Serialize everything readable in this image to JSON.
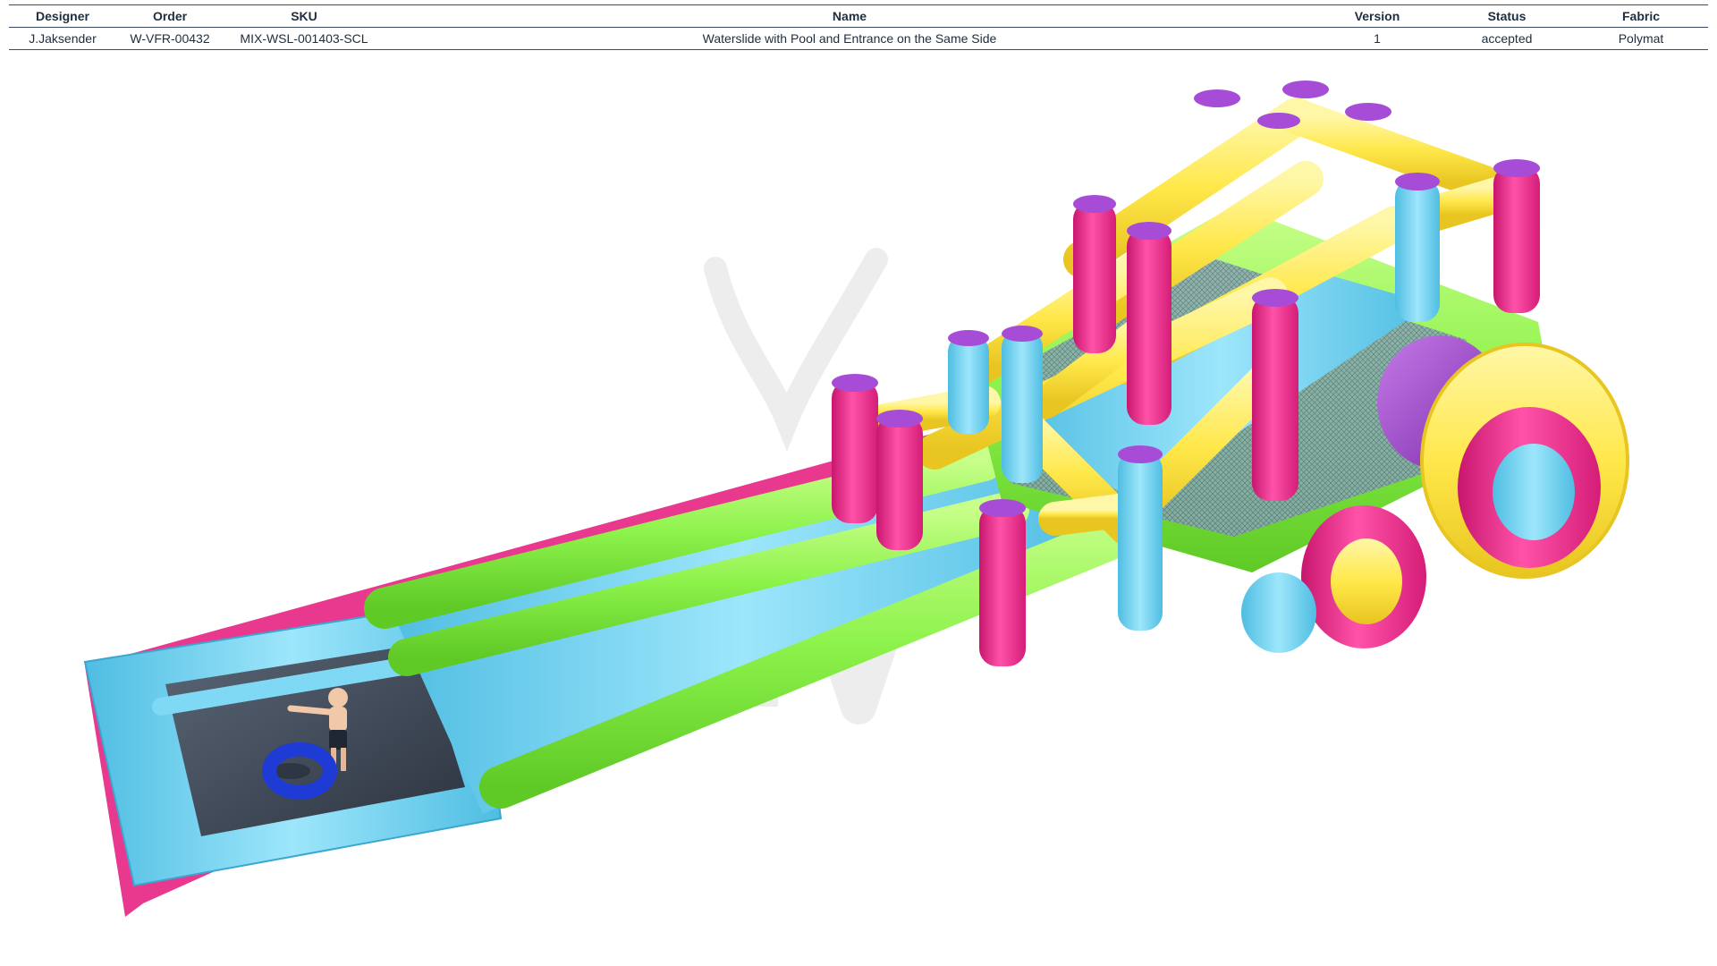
{
  "spec_table": {
    "headers": {
      "designer": "Designer",
      "order": "Order",
      "sku": "SKU",
      "name": "Name",
      "version": "Version",
      "status": "Status",
      "fabric": "Fabric"
    },
    "row": {
      "designer": "J.Jaksender",
      "order": "W-VFR-00432",
      "sku": "MIX-WSL-001403-SCL",
      "name": "Waterslide with Pool and Entrance on the Same Side",
      "version": "1",
      "status": "accepted",
      "fabric": "Polymat"
    }
  },
  "render": {
    "subject": "inflatable-waterslide-render",
    "watermark_style": "faint-grey-logo",
    "colors": {
      "pink": "#ff3d9a",
      "yellow": "#ffe84a",
      "green": "#8cf24a",
      "blue": "#6fd4f2",
      "purple": "#a64cd6",
      "pool_water": "#3b4452",
      "tube": "#1f3bd6",
      "text": "#1f2d3d",
      "rule": "#3b4b5e"
    }
  }
}
